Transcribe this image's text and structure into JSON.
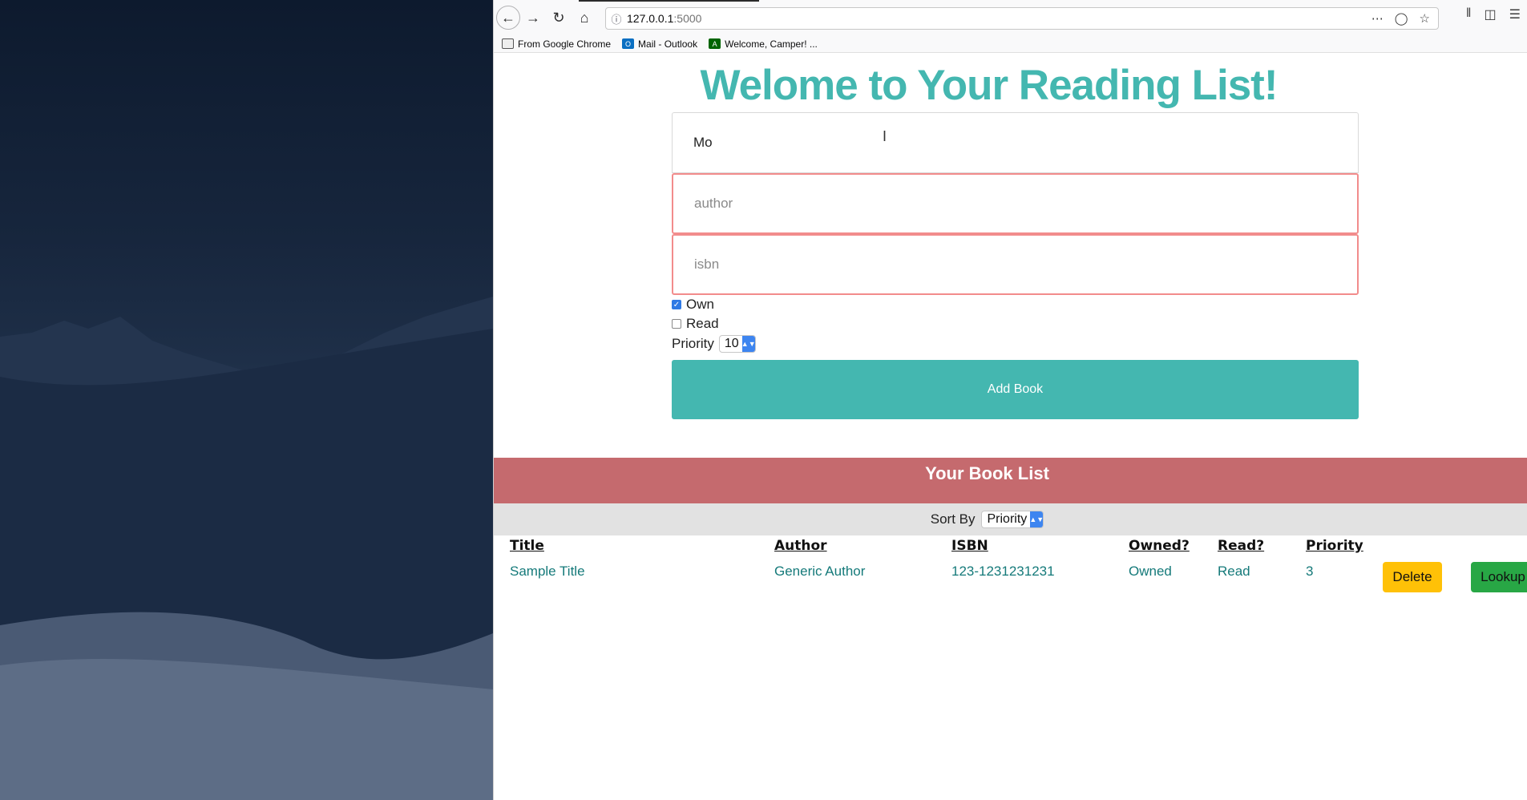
{
  "browser": {
    "url_host": "127.0.0.1",
    "url_port": ":5000",
    "bookmarks": [
      {
        "label": "From Google Chrome",
        "icon": "folder-icon"
      },
      {
        "label": "Mail - Outlook",
        "icon": "outlook-icon"
      },
      {
        "label": "Welcome, Camper! ...",
        "icon": "freecodecamp-icon"
      }
    ]
  },
  "page": {
    "title": "Welome to Your Reading List!",
    "form": {
      "title_value": "Mo",
      "author_placeholder": "author",
      "isbn_placeholder": "isbn",
      "own_label": "Own",
      "own_checked": true,
      "read_label": "Read",
      "read_checked": false,
      "priority_label": "Priority",
      "priority_value": "10",
      "submit_label": "Add Book"
    },
    "list": {
      "header": "Your Book List",
      "sort_label": "Sort By",
      "sort_value": "Priority",
      "columns": [
        "Title",
        "Author",
        "ISBN",
        "Owned?",
        "Read?",
        "Priority"
      ],
      "rows": [
        {
          "title": "Sample Title",
          "author": "Generic Author",
          "isbn": "123-1231231231",
          "owned": "Owned",
          "read": "Read",
          "priority": "3",
          "delete_label": "Delete",
          "lookup_label": "Lookup"
        }
      ]
    }
  },
  "colors": {
    "accent": "#44b7b0",
    "list_header": "#c56a6e",
    "delete": "#ffc107",
    "lookup": "#28a745",
    "invalid_border": "#f28c8c"
  }
}
